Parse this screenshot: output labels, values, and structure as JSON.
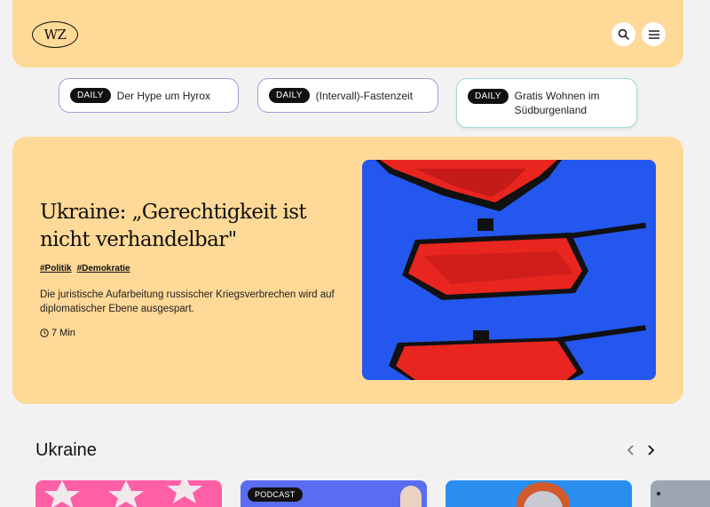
{
  "header": {
    "logo_text": "WZ",
    "search_icon": "search-icon",
    "menu_icon": "hamburger-menu-icon"
  },
  "daily_pills": [
    {
      "tag": "DAILY",
      "text": "Der Hype um Hyrox"
    },
    {
      "tag": "DAILY",
      "text": "(Intervall)-Fastenzeit"
    },
    {
      "tag": "DAILY",
      "text": "Gratis Wohnen im Südburgenland"
    }
  ],
  "hero": {
    "title": "Ukraine: „Gerechtigkeit ist nicht verhandelbar\"",
    "tags": [
      "#Politik",
      "#Demokratie"
    ],
    "description": "Die juristische Aufarbeitung russischer Kriegsverbrechen wird auf diplomatischer Ebene ausgespart.",
    "read_time": "7 Min",
    "image_colors": {
      "background": "#2457ee",
      "paper": "#e8251f",
      "tank": "#111111"
    }
  },
  "section": {
    "title": "Ukraine",
    "prev_icon": "chevron-left-icon",
    "next_icon": "chevron-right-icon"
  },
  "cards": [
    {
      "label": ""
    },
    {
      "label": "PODCAST"
    },
    {
      "label": ""
    },
    {
      "label": ""
    }
  ],
  "colors": {
    "accent": "#ffd997",
    "page_bg": "#f2f2f2",
    "pill_border": "#a79ad8",
    "pill_border_alt": "#9fd9d9"
  }
}
